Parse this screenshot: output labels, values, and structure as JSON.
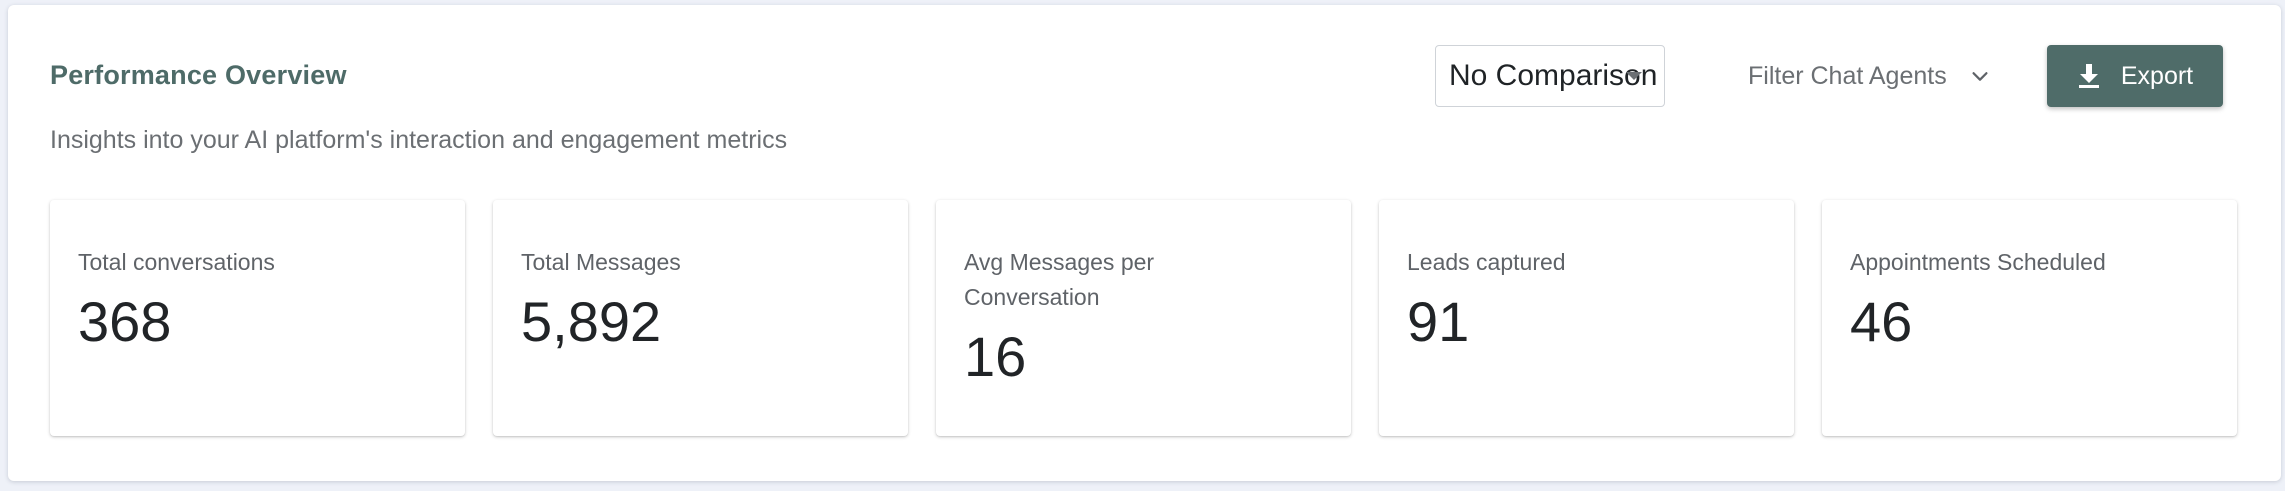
{
  "header": {
    "title": "Performance Overview",
    "subtitle": "Insights into your AI platform's interaction and engagement metrics"
  },
  "controls": {
    "comparison_select": {
      "selected": "No Comparison"
    },
    "filter_label": "Filter Chat Agents",
    "export_label": "Export"
  },
  "metrics": [
    {
      "label": "Total conversations",
      "value": "368"
    },
    {
      "label": "Total Messages",
      "value": "5,892"
    },
    {
      "label": "Avg Messages per Conversation",
      "value": "16"
    },
    {
      "label": "Leads captured",
      "value": "91"
    },
    {
      "label": "Appointments Scheduled",
      "value": "46"
    }
  ],
  "colors": {
    "accent": "#4f6c69",
    "title": "#4e6b68",
    "background": "#eef1f8"
  },
  "icons": {
    "select_caret": "caret-down-icon",
    "filter_chevron": "chevron-down-icon",
    "export_icon": "download-icon"
  }
}
